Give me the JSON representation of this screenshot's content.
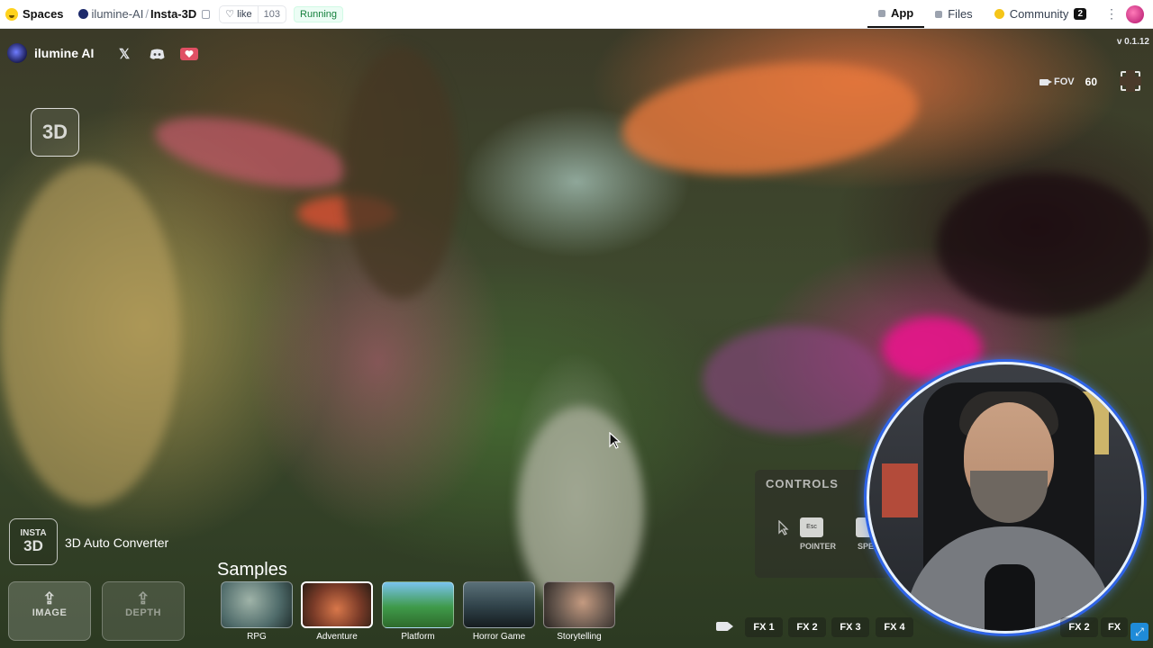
{
  "topbar": {
    "spaces_label": "Spaces",
    "org": "ilumine-AI",
    "separator": "/",
    "space_name": "Insta-3D",
    "like_label": "like",
    "like_count": "103",
    "status": "Running",
    "tabs": [
      {
        "label": "App",
        "active": true
      },
      {
        "label": "Files",
        "active": false
      },
      {
        "label": "Community",
        "active": false,
        "badge": "2"
      }
    ]
  },
  "viewer": {
    "brand": "ilumine AI",
    "social_icons": [
      "x-icon",
      "discord-icon",
      "patreon-icon"
    ],
    "version": "v 0.1.12",
    "badge_3d": "3D",
    "fov_label": "FOV",
    "fov_value": "60",
    "controls_title": "CONTROLS",
    "controls": [
      {
        "key": "Esc",
        "label": "POINTER"
      },
      {
        "key": "",
        "label": "SPE"
      }
    ]
  },
  "app": {
    "insta_top": "INSTA",
    "insta_bottom": "3D",
    "converter_title": "3D Auto Converter",
    "upload_image_label": "IMAGE",
    "upload_depth_label": "DEPTH",
    "samples_title": "Samples",
    "samples": [
      {
        "label": "RPG",
        "selected": false,
        "color": "#4f6b6a"
      },
      {
        "label": "Adventure",
        "selected": true,
        "color": "#7a3b28"
      },
      {
        "label": "Platform",
        "selected": false,
        "color": "#3f9a4a"
      },
      {
        "label": "Horror Game",
        "selected": false,
        "color": "#2f4148"
      },
      {
        "label": "Storytelling",
        "selected": false,
        "color": "#6a5a50"
      }
    ],
    "fx_buttons": [
      "FX 1",
      "FX 2",
      "FX 3",
      "FX 4"
    ],
    "fx_buttons_right": [
      "FX 2",
      "FX"
    ]
  }
}
